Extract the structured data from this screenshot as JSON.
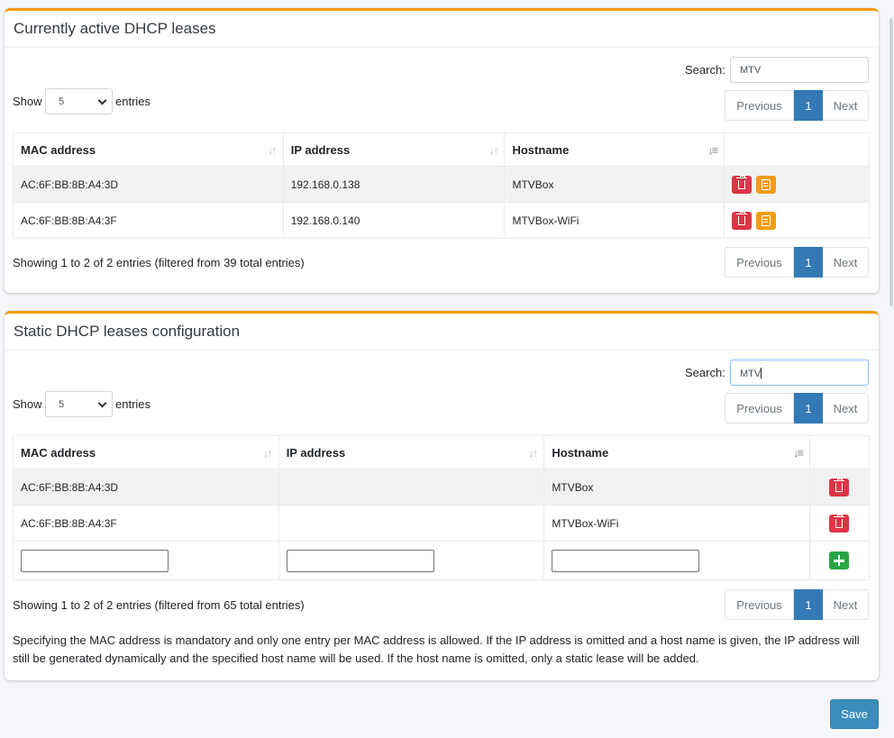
{
  "active_leases": {
    "title": "Currently active DHCP leases",
    "search_label": "Search:",
    "search_value": "MTV",
    "show_label": "Show",
    "entries_value": "5",
    "entries_label": "entries",
    "pager": {
      "prev": "Previous",
      "page": "1",
      "next": "Next"
    },
    "columns": [
      "MAC address",
      "IP address",
      "Hostname"
    ],
    "rows": [
      {
        "mac": "AC:6F:BB:8B:A4:3D",
        "ip": "192.168.0.138",
        "host": "MTVBox"
      },
      {
        "mac": "AC:6F:BB:8B:A4:3F",
        "ip": "192.168.0.140",
        "host": "MTVBox-WiFi"
      }
    ],
    "info": "Showing 1 to 2 of 2 entries (filtered from 39 total entries)"
  },
  "static_leases": {
    "title": "Static DHCP leases configuration",
    "search_label": "Search:",
    "search_value": "MTV",
    "show_label": "Show",
    "entries_value": "5",
    "entries_label": "entries",
    "pager": {
      "prev": "Previous",
      "page": "1",
      "next": "Next"
    },
    "columns": [
      "MAC address",
      "IP address",
      "Hostname"
    ],
    "rows": [
      {
        "mac": "AC:6F:BB:8B:A4:3D",
        "ip": "",
        "host": "MTVBox"
      },
      {
        "mac": "AC:6F:BB:8B:A4:3F",
        "ip": "",
        "host": "MTVBox-WiFi"
      }
    ],
    "info": "Showing 1 to 2 of 2 entries (filtered from 65 total entries)",
    "note": "Specifying the MAC address is mandatory and only one entry per MAC address is allowed. If the IP address is omitted and a host name is given, the IP address will still be generated dynamically and the specified host name will be used. If the host name is omitted, only a static lease will be added."
  },
  "save_label": "Save",
  "colors": {
    "accent": "#f39c12",
    "primary": "#337ab7",
    "danger": "#dc3545",
    "success": "#28a745",
    "save": "#3c8dbc"
  }
}
